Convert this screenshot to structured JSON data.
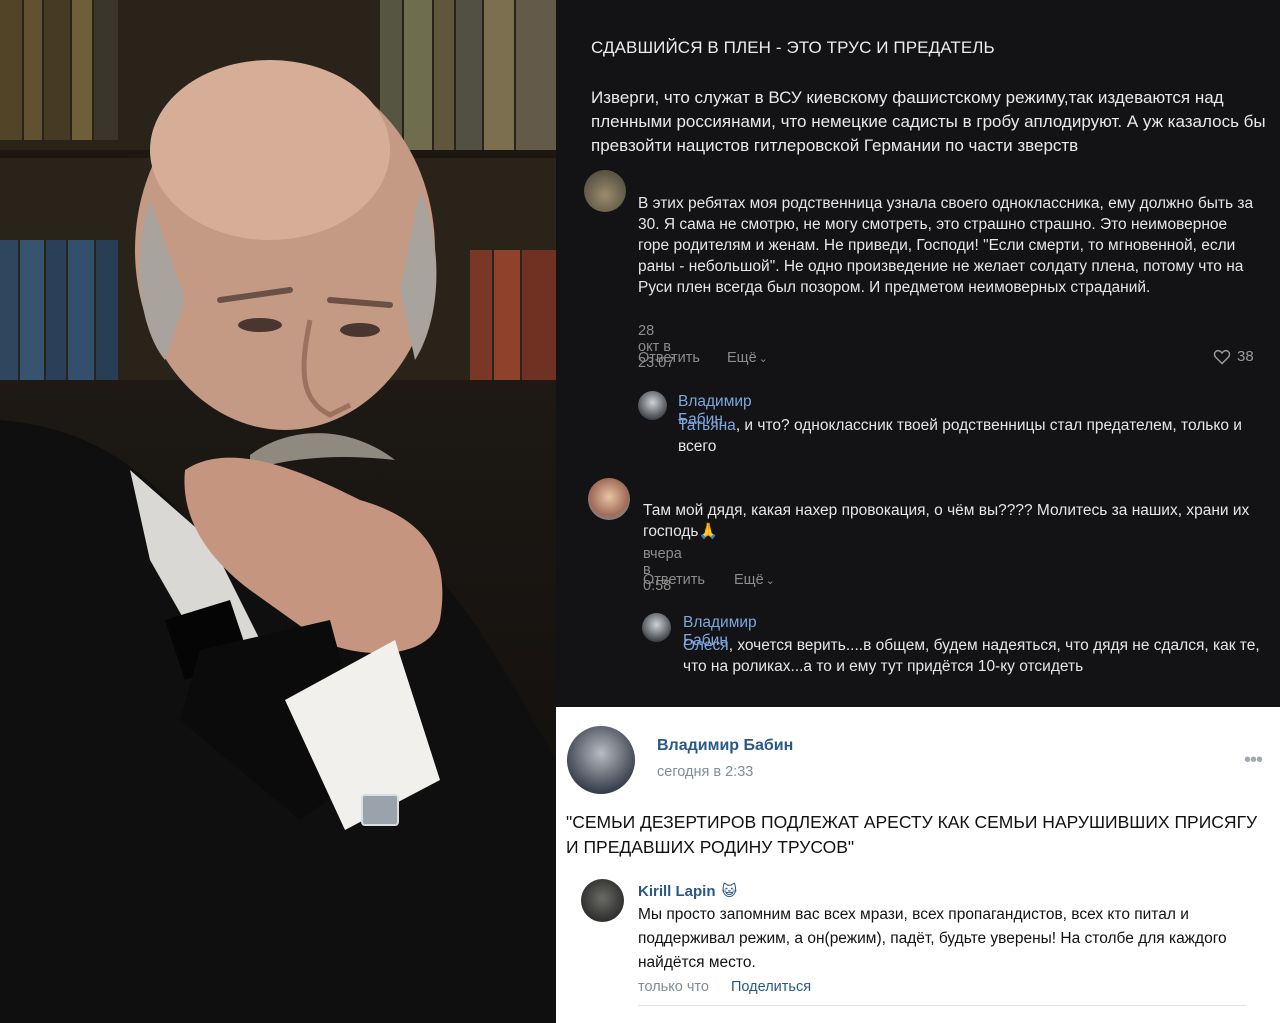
{
  "dark_post": {
    "heading": "СДАВШИЙСЯ В ПЛЕН - ЭТО ТРУС И ПРЕДАТЕЛЬ",
    "body": "Изверги, что служат в ВСУ киевскому фашистскому режиму,так издеваются над пленными россиянами, что немецкие садисты в гробу аплодируют. А уж казалось бы превзойти нацистов гитлеровской Германии по части зверств"
  },
  "comments": [
    {
      "text": "В этих ребятах моя родственница узнала своего одноклассника, ему должно быть за 30. Я сама не смотрю, не могу смотреть, это страшно страшно. Это неимоверное горе родителям и женам. Не приведи, Господи! \"Если смерти, то мгновенной, если раны - небольшой\". Не одно произведение не желает солдату плена, потому что на Руси плен всегда был позором. И предметом неимоверных страданий.",
      "time": "28 окт в 23:07",
      "reply": "Ответить",
      "more": "Ещё",
      "likes": "38"
    },
    {
      "text": "Там мой дядя, какая нахер провокация, о чём вы???? Молитесь за наших, храни их господь",
      "emoji": "🙏",
      "time": "вчера в 0:58",
      "reply": "Ответить",
      "more": "Ещё"
    }
  ],
  "replies": [
    {
      "name": "Владимир Бабин",
      "addressee": "Татьяна",
      "text": ", и что? одноклассник твоей родственницы стал предателем, только и всего"
    },
    {
      "name": "Владимир Бабин",
      "addressee": "Олеся",
      "text": ", хочется верить....в общем, будем надеяться, что дядя не сдался, как те, что на роликах...а то и ему тут придётся 10-ку отсидеть"
    }
  ],
  "vk_post": {
    "author": "Владимир Бабин",
    "time": "сегодня в 2:33",
    "more": "•••",
    "text": "\"СЕМЬИ ДЕЗЕРТИРОВ ПОДЛЕЖАТ АРЕСТУ КАК СЕМЬИ НАРУШИВШИХ ПРИСЯГУ И ПРЕДАВШИХ РОДИНУ ТРУСОВ\"",
    "comment": {
      "name": "Kirill Lapin",
      "emoji": "😺",
      "text": "Мы просто запомним вас всех мрази, всех пропагандистов, всех кто питал и поддерживал режим, а он(режим), падёт, будьте уверены! На столбе для каждого найдётся место.",
      "time": "только что",
      "share": "Поделиться"
    }
  },
  "colors": {
    "dark_bg": "#131315",
    "link_dark": "#7ea6dd",
    "link_light": "#2a5885",
    "meta_light": "#818c99"
  }
}
